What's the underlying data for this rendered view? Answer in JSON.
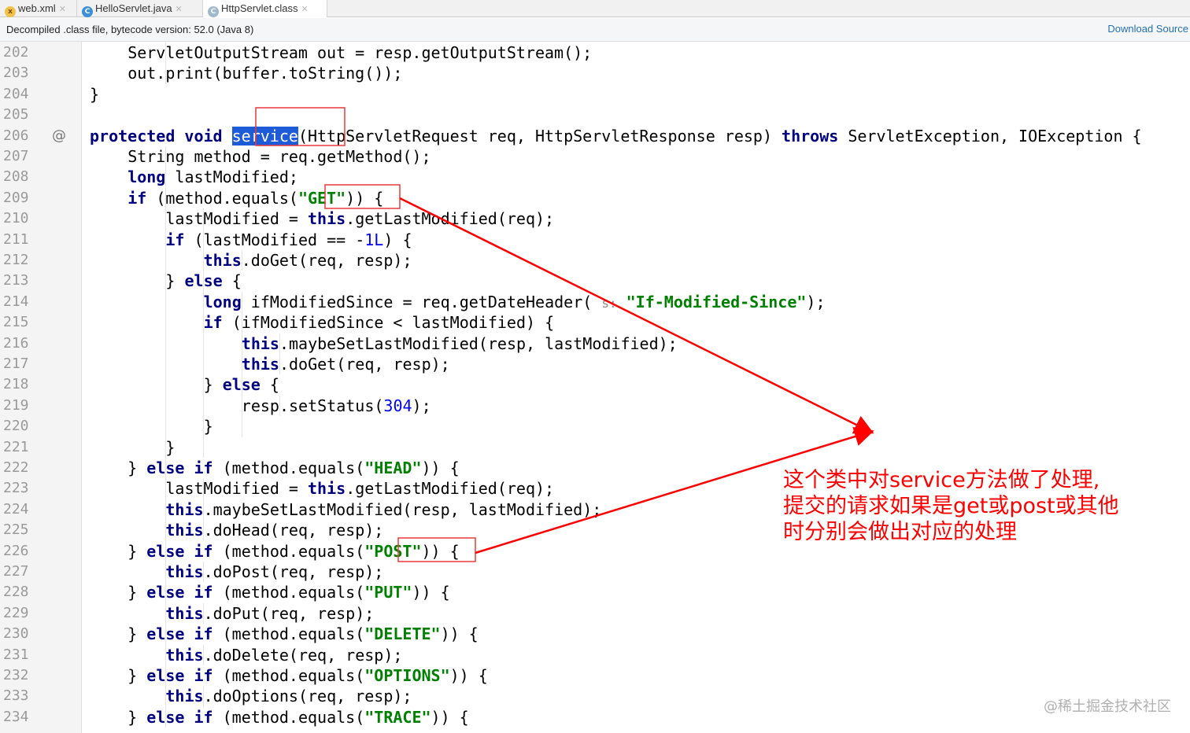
{
  "tabs": [
    {
      "label": "web.xml",
      "icon": "xml-file-icon"
    },
    {
      "label": "HelloServlet.java",
      "icon": "java-class-icon"
    },
    {
      "label": "HttpServlet.class",
      "icon": "compiled-class-icon",
      "active": true
    }
  ],
  "banner": {
    "message": "Decompiled .class file, bytecode version: 52.0 (Java 8)",
    "action": "Download Source"
  },
  "code": {
    "lines": [
      {
        "n": "202",
        "indent": 2,
        "parts": [
          [
            "t",
            "ServletOutputStream out = resp.getOutputStream();"
          ]
        ]
      },
      {
        "n": "203",
        "indent": 2,
        "parts": [
          [
            "t",
            "out.print(buffer.toString());"
          ]
        ]
      },
      {
        "n": "204",
        "indent": 1,
        "parts": [
          [
            "t",
            "}"
          ]
        ]
      },
      {
        "n": "205",
        "indent": 0,
        "parts": []
      },
      {
        "n": "206",
        "indent": 1,
        "mark": "@",
        "parts": [
          [
            "k",
            "protected"
          ],
          [
            "t",
            " "
          ],
          [
            "k",
            "void"
          ],
          [
            "t",
            " "
          ],
          [
            "s",
            "service"
          ],
          [
            "t",
            "(HttpServletRequest req, HttpServletResponse resp) "
          ],
          [
            "k",
            "throws"
          ],
          [
            "t",
            " ServletException, IOException {"
          ]
        ]
      },
      {
        "n": "207",
        "indent": 2,
        "parts": [
          [
            "t",
            "String method = req.getMethod();"
          ]
        ]
      },
      {
        "n": "208",
        "indent": 2,
        "parts": [
          [
            "k",
            "long"
          ],
          [
            "t",
            " lastModified;"
          ]
        ]
      },
      {
        "n": "209",
        "indent": 2,
        "parts": [
          [
            "k",
            "if"
          ],
          [
            "t",
            " (method.equals("
          ],
          [
            "g",
            "\"GET\""
          ],
          [
            "t",
            ")) {"
          ]
        ]
      },
      {
        "n": "210",
        "indent": 3,
        "parts": [
          [
            "t",
            "lastModified = "
          ],
          [
            "k",
            "this"
          ],
          [
            "t",
            ".getLastModified(req);"
          ]
        ]
      },
      {
        "n": "211",
        "indent": 3,
        "parts": [
          [
            "k",
            "if"
          ],
          [
            "t",
            " (lastModified == -"
          ],
          [
            "d",
            "1L"
          ],
          [
            "t",
            ") {"
          ]
        ]
      },
      {
        "n": "212",
        "indent": 4,
        "parts": [
          [
            "k",
            "this"
          ],
          [
            "t",
            ".doGet(req, resp);"
          ]
        ]
      },
      {
        "n": "213",
        "indent": 3,
        "parts": [
          [
            "t",
            "} "
          ],
          [
            "k",
            "else"
          ],
          [
            "t",
            " {"
          ]
        ]
      },
      {
        "n": "214",
        "indent": 4,
        "parts": [
          [
            "k",
            "long"
          ],
          [
            "t",
            " ifModifiedSince = req.getDateHeader( "
          ],
          [
            "h",
            "s:"
          ],
          [
            "t",
            " "
          ],
          [
            "g",
            "\"If-Modified-Since\""
          ],
          [
            "t",
            ");"
          ]
        ]
      },
      {
        "n": "215",
        "indent": 4,
        "parts": [
          [
            "k",
            "if"
          ],
          [
            "t",
            " (ifModifiedSince < lastModified) {"
          ]
        ]
      },
      {
        "n": "216",
        "indent": 5,
        "parts": [
          [
            "k",
            "this"
          ],
          [
            "t",
            ".maybeSetLastModified(resp, lastModified);"
          ]
        ]
      },
      {
        "n": "217",
        "indent": 5,
        "parts": [
          [
            "k",
            "this"
          ],
          [
            "t",
            ".doGet(req, resp);"
          ]
        ]
      },
      {
        "n": "218",
        "indent": 4,
        "parts": [
          [
            "t",
            "} "
          ],
          [
            "k",
            "else"
          ],
          [
            "t",
            " {"
          ]
        ]
      },
      {
        "n": "219",
        "indent": 5,
        "parts": [
          [
            "t",
            "resp.setStatus("
          ],
          [
            "d",
            "304"
          ],
          [
            "t",
            ");"
          ]
        ]
      },
      {
        "n": "220",
        "indent": 4,
        "parts": [
          [
            "t",
            "}"
          ]
        ]
      },
      {
        "n": "221",
        "indent": 3,
        "parts": [
          [
            "t",
            "}"
          ]
        ]
      },
      {
        "n": "222",
        "indent": 2,
        "parts": [
          [
            "t",
            "} "
          ],
          [
            "k",
            "else if"
          ],
          [
            "t",
            " (method.equals("
          ],
          [
            "g",
            "\"HEAD\""
          ],
          [
            "t",
            ")) {"
          ]
        ]
      },
      {
        "n": "223",
        "indent": 3,
        "parts": [
          [
            "t",
            "lastModified = "
          ],
          [
            "k",
            "this"
          ],
          [
            "t",
            ".getLastModified(req);"
          ]
        ]
      },
      {
        "n": "224",
        "indent": 3,
        "parts": [
          [
            "k",
            "this"
          ],
          [
            "t",
            ".maybeSetLastModified(resp, lastModified);"
          ]
        ]
      },
      {
        "n": "225",
        "indent": 3,
        "parts": [
          [
            "k",
            "this"
          ],
          [
            "t",
            ".doHead(req, resp);"
          ]
        ]
      },
      {
        "n": "226",
        "indent": 2,
        "parts": [
          [
            "t",
            "} "
          ],
          [
            "k",
            "else if"
          ],
          [
            "t",
            " (method.equals("
          ],
          [
            "g",
            "\"POST\""
          ],
          [
            "t",
            ")) {"
          ]
        ]
      },
      {
        "n": "227",
        "indent": 3,
        "parts": [
          [
            "k",
            "this"
          ],
          [
            "t",
            ".doPost(req, resp);"
          ]
        ]
      },
      {
        "n": "228",
        "indent": 2,
        "parts": [
          [
            "t",
            "} "
          ],
          [
            "k",
            "else if"
          ],
          [
            "t",
            " (method.equals("
          ],
          [
            "g",
            "\"PUT\""
          ],
          [
            "t",
            ")) {"
          ]
        ]
      },
      {
        "n": "229",
        "indent": 3,
        "parts": [
          [
            "k",
            "this"
          ],
          [
            "t",
            ".doPut(req, resp);"
          ]
        ]
      },
      {
        "n": "230",
        "indent": 2,
        "parts": [
          [
            "t",
            "} "
          ],
          [
            "k",
            "else if"
          ],
          [
            "t",
            " (method.equals("
          ],
          [
            "g",
            "\"DELETE\""
          ],
          [
            "t",
            ")) {"
          ]
        ]
      },
      {
        "n": "231",
        "indent": 3,
        "parts": [
          [
            "k",
            "this"
          ],
          [
            "t",
            ".doDelete(req, resp);"
          ]
        ]
      },
      {
        "n": "232",
        "indent": 2,
        "parts": [
          [
            "t",
            "} "
          ],
          [
            "k",
            "else if"
          ],
          [
            "t",
            " (method.equals("
          ],
          [
            "g",
            "\"OPTIONS\""
          ],
          [
            "t",
            ")) {"
          ]
        ]
      },
      {
        "n": "233",
        "indent": 3,
        "parts": [
          [
            "k",
            "this"
          ],
          [
            "t",
            ".doOptions(req, resp);"
          ]
        ]
      },
      {
        "n": "234",
        "indent": 2,
        "parts": [
          [
            "t",
            "} "
          ],
          [
            "k",
            "else if"
          ],
          [
            "t",
            " (method.equals("
          ],
          [
            "g",
            "\"TRACE\""
          ],
          [
            "t",
            ")) {"
          ]
        ]
      }
    ]
  },
  "annotation": {
    "lines": [
      "这个类中对service方法做了处理,",
      "提交的请求如果是get或post或其他",
      "时分别会做出对应的处理"
    ]
  },
  "watermark": "@稀土掘金技术社区",
  "colors": {
    "keyword": "#000080",
    "string": "#008000",
    "number": "#0000ff",
    "annotation": "#ff0000",
    "selection": "#1e5bd6"
  }
}
